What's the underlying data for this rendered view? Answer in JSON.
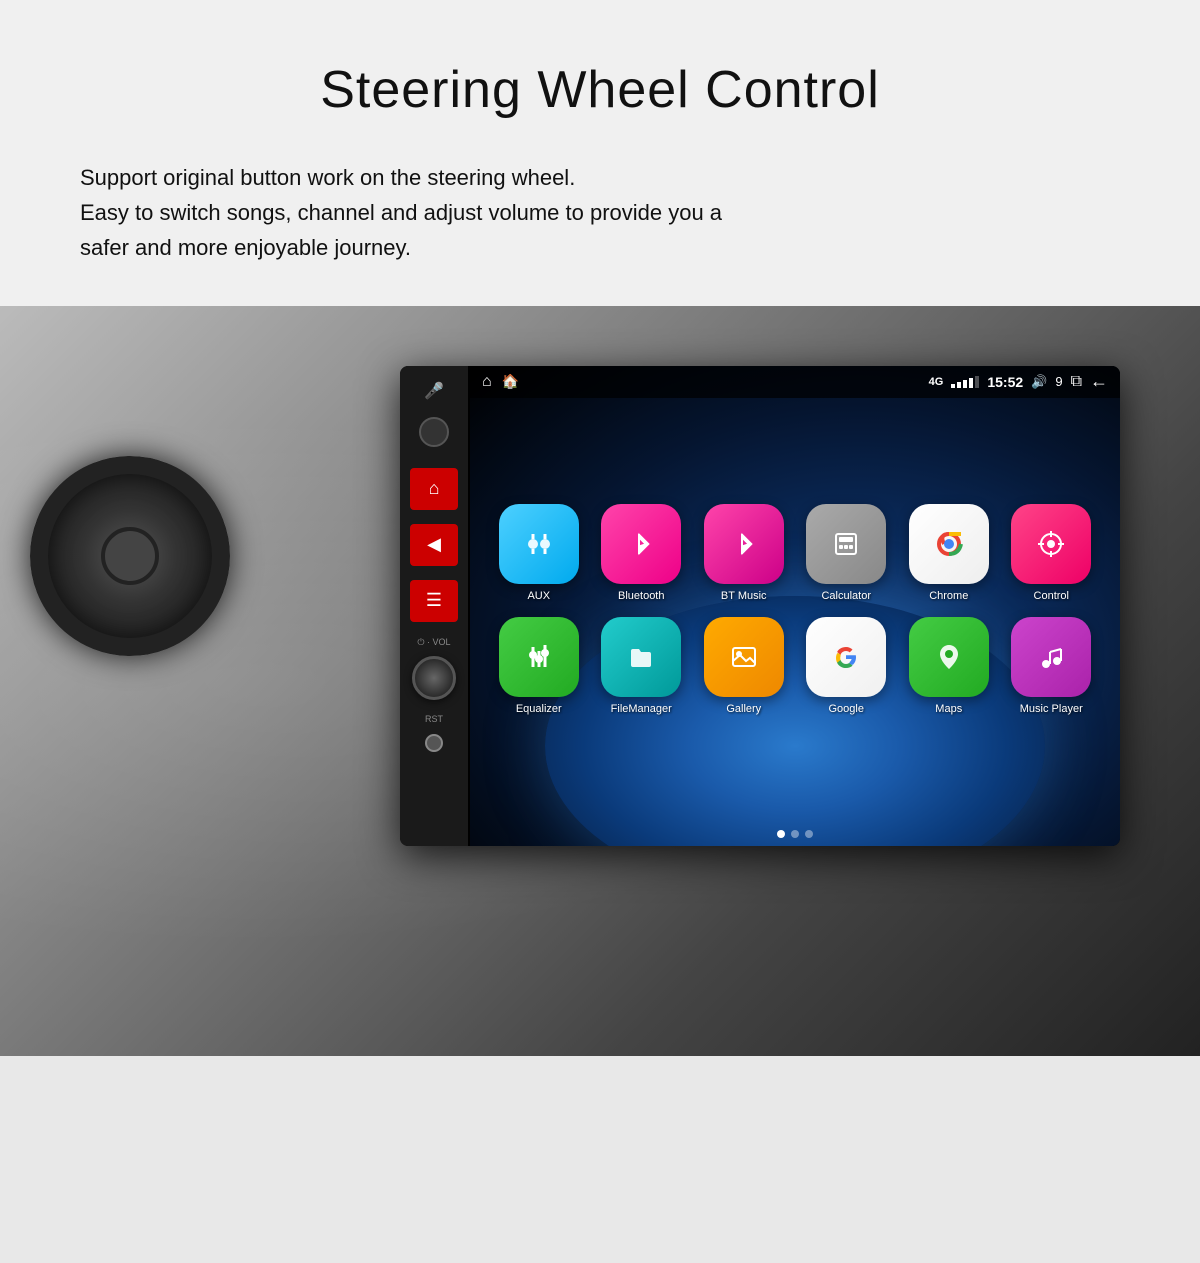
{
  "page": {
    "title": "Steering Wheel Control",
    "description_line1": "Support original button work on the steering wheel.",
    "description_line2": "Easy to switch songs, channel and adjust volume to provide you a",
    "description_line3": "safer and more enjoyable journey."
  },
  "status_bar": {
    "signal_text": "4G",
    "time": "15:52",
    "volume_number": "9",
    "home_icon": "⌂",
    "back_arrow": "←"
  },
  "apps_row1": [
    {
      "id": "aux",
      "label": "AUX",
      "icon": "⚡",
      "color_class": "icon-aux"
    },
    {
      "id": "bluetooth",
      "label": "Bluetooth",
      "icon": "ᛒ",
      "color_class": "icon-bluetooth"
    },
    {
      "id": "btmusic",
      "label": "BT Music",
      "icon": "ᛒ",
      "color_class": "icon-btmusic"
    },
    {
      "id": "calculator",
      "label": "Calculator",
      "icon": "⊞",
      "color_class": "icon-calculator"
    },
    {
      "id": "chrome",
      "label": "Chrome",
      "icon": "◎",
      "color_class": "icon-chrome"
    },
    {
      "id": "control",
      "label": "Control",
      "icon": "⊙",
      "color_class": "icon-control"
    }
  ],
  "apps_row2": [
    {
      "id": "equalizer",
      "label": "Equalizer",
      "icon": "≋",
      "color_class": "icon-equalizer"
    },
    {
      "id": "filemanager",
      "label": "FileManager",
      "icon": "📁",
      "color_class": "icon-filemanager"
    },
    {
      "id": "gallery",
      "label": "Gallery",
      "icon": "🖼",
      "color_class": "icon-gallery"
    },
    {
      "id": "google",
      "label": "Google",
      "icon": "G",
      "color_class": "icon-google"
    },
    {
      "id": "maps",
      "label": "Maps",
      "icon": "📍",
      "color_class": "icon-maps"
    },
    {
      "id": "musicplayer",
      "label": "Music Player",
      "icon": "♪",
      "color_class": "icon-musicplayer"
    }
  ],
  "left_panel": {
    "buttons": [
      {
        "id": "home-btn",
        "label": "⌂"
      },
      {
        "id": "back-btn",
        "label": "◀"
      },
      {
        "id": "menu-btn",
        "label": "☰"
      }
    ],
    "vol_label": "⏻ · VOL",
    "rst_label": "RST"
  },
  "pagination": {
    "dots": [
      true,
      false,
      false
    ]
  }
}
